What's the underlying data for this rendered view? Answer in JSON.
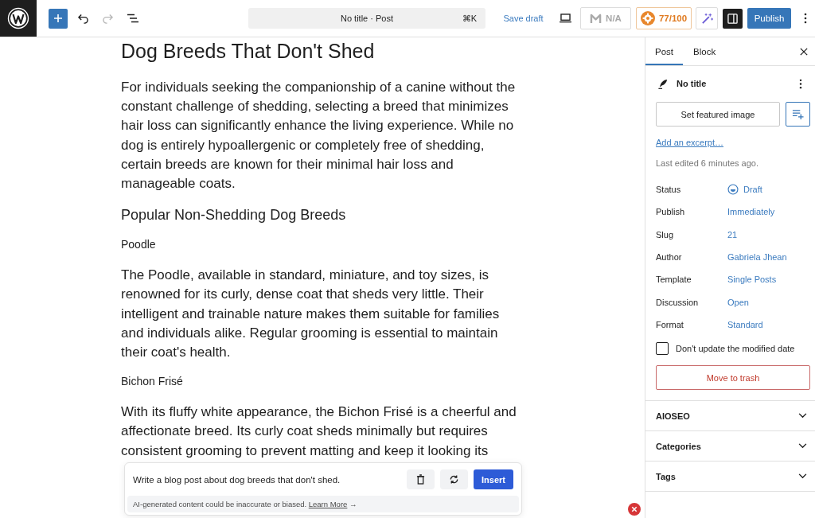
{
  "toolbar": {
    "document_title": "No title · Post",
    "shortcut": "⌘K",
    "undo": {
      "disabled": false
    },
    "redo": {
      "disabled": true
    },
    "save_draft": "Save draft",
    "readability": {
      "label": "N/A"
    },
    "seo_score": {
      "label": "77/100"
    },
    "sidebar_toggle": {
      "pressed": true
    },
    "publish": "Publish"
  },
  "content": [
    {
      "kind": "title",
      "lines": [
        "Dog Breeds That Don't Shed"
      ]
    },
    {
      "kind": "paragraph",
      "lines": [
        "For individuals seeking the companionship of a canine without the",
        "constant challenge of shedding, selecting a breed that minimizes",
        "hair loss can significantly enhance the living experience. While no",
        "dog is entirely hypoallergenic or completely free of shedding,",
        "certain breeds are known for their minimal hair loss and",
        "manageable coats."
      ]
    },
    {
      "kind": "heading",
      "lines": [
        "Popular Non-Shedding Dog Breeds"
      ]
    },
    {
      "kind": "subheading",
      "lines": [
        "Poodle"
      ]
    },
    {
      "kind": "paragraph",
      "lines": [
        "The Poodle, available in standard, miniature, and toy sizes, is",
        "renowned for its curly, dense coat that sheds very little. Their",
        "intelligent and trainable nature makes them suitable for families",
        "and individuals alike. Regular grooming is essential to maintain",
        "their coat's health."
      ]
    },
    {
      "kind": "subheading",
      "lines": [
        "Bichon Frisé"
      ]
    },
    {
      "kind": "paragraph",
      "lines": [
        "With its fluffy white appearance, the Bichon Frisé is a cheerful and",
        "affectionate breed. Its curly coat sheds minimally but requires",
        "consistent grooming to prevent matting and keep it looking its"
      ]
    }
  ],
  "ai_prompt": {
    "prompt": "Write a blog post about dog breeds that don't shed.",
    "insert": "Insert",
    "disclaimer": "AI-generated content could be inaccurate or biased.",
    "link": "Learn More",
    "arrow": "→"
  },
  "sidebar": {
    "tabs": [
      {
        "label": "Post",
        "selected": true
      },
      {
        "label": "Block",
        "selected": false
      }
    ],
    "post_title": "No title",
    "featured_image": "Set featured image",
    "excerpt_link": "Add an excerpt…",
    "last_edited": "Last edited 6 minutes ago.",
    "fields": [
      {
        "kind": "status",
        "label": "Status",
        "value": "Draft"
      },
      {
        "kind": "link",
        "label": "Publish",
        "value": "Immediately"
      },
      {
        "kind": "link",
        "label": "Slug",
        "value": "21"
      },
      {
        "kind": "link",
        "label": "Author",
        "value": "Gabriela Jhean"
      },
      {
        "kind": "link",
        "label": "Template",
        "value": "Single Posts"
      },
      {
        "kind": "link",
        "label": "Discussion",
        "value": "Open"
      },
      {
        "kind": "link",
        "label": "Format",
        "value": "Standard"
      }
    ],
    "keep_date": {
      "label": "Don't update the modified date",
      "checked": false
    },
    "trash": "Move to trash",
    "panels": [
      {
        "title": "AIOSEO",
        "expanded": false
      },
      {
        "title": "Categories",
        "expanded": false
      },
      {
        "title": "Tags",
        "expanded": false
      }
    ]
  }
}
